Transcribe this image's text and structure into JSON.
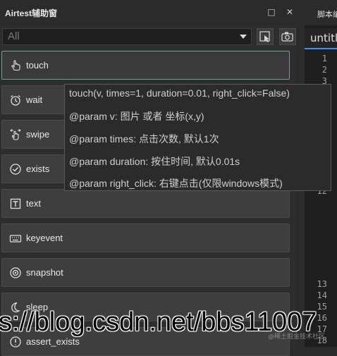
{
  "panel": {
    "title": "Airtest辅助窗",
    "restore_icon": "□",
    "close_icon": "✕",
    "filter": {
      "value": "All"
    }
  },
  "items": [
    {
      "label": "touch",
      "icon": "hand-pointer-icon",
      "active": true
    },
    {
      "label": "wait",
      "icon": "alarm-clock-icon"
    },
    {
      "label": "swipe",
      "icon": "swipe-hand-icon"
    },
    {
      "label": "exists",
      "icon": "check-circle-icon"
    },
    {
      "label": "text",
      "icon": "text-box-icon"
    },
    {
      "label": "keyevent",
      "icon": "keyboard-icon"
    },
    {
      "label": "snapshot",
      "icon": "camera-icon"
    },
    {
      "label": "sleep",
      "icon": "moon-icon"
    },
    {
      "label": "assert_exists",
      "icon": "assert-icon"
    }
  ],
  "tooltip": {
    "signature": "touch(v, times=1, duration=0.01, right_click=False)",
    "param_v": "@param v: 图片 或者 坐标(x,y)",
    "param_times": "@param times: 点击次数, 默认1次",
    "param_duration": "@param duration: 按住时间, 默认0.01s",
    "param_right_click": "@param right_click: 右键点击(仅限windows模式)"
  },
  "editor": {
    "panel_label": "脚本编",
    "doc_tab": "untitl",
    "line_numbers_top": [
      "1",
      "2",
      "3"
    ],
    "line_number_partial": "12",
    "line_numbers_bottom": [
      "13",
      "14",
      "15",
      "16",
      "17",
      "18"
    ]
  },
  "watermark": {
    "url": "s://blog.csdn.net/bbs11007",
    "small": "@稀土掘金技术社区"
  },
  "colors": {
    "panel_bg": "#2d2d2d",
    "item_bg": "#3e3e3e",
    "active_border": "#7a9a9a",
    "editor_bg": "#1e1e1e",
    "tab_accent": "#3794ff"
  }
}
